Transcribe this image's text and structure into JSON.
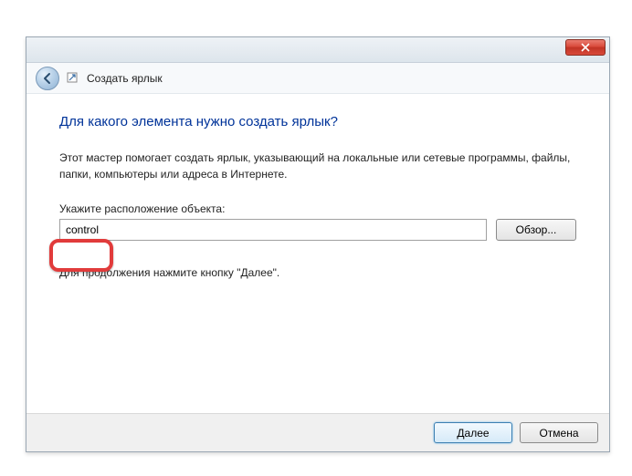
{
  "header": {
    "title": "Создать ярлык"
  },
  "main": {
    "heading": "Для какого элемента нужно создать ярлык?",
    "description": "Этот мастер помогает создать ярлык, указывающий на локальные или сетевые программы, файлы, папки, компьютеры или адреса в Интернете.",
    "field_label": "Укажите расположение объекта:",
    "location_value": "control",
    "browse_label": "Обзор...",
    "continue_text": "Для продолжения нажмите кнопку \"Далее\"."
  },
  "footer": {
    "next_label": "Далее",
    "cancel_label": "Отмена"
  }
}
